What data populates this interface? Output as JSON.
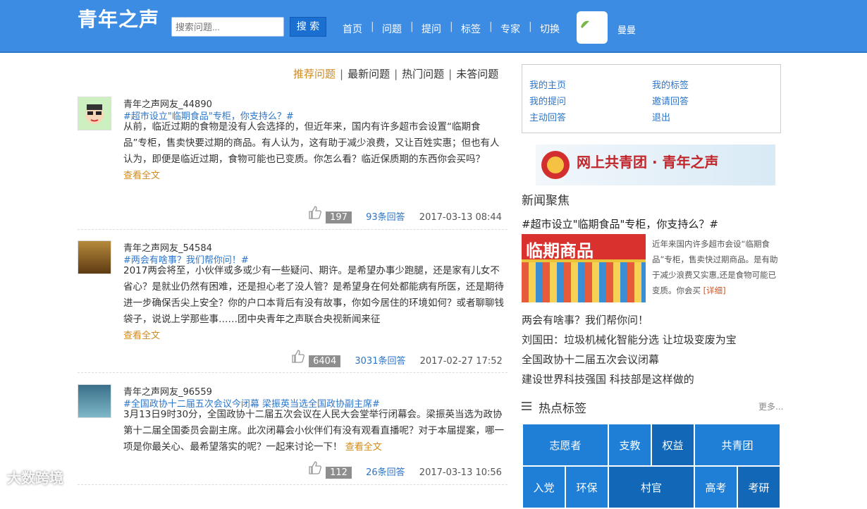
{
  "header": {
    "logo": "青年之声",
    "search_placeholder": "搜索问题...",
    "search_button": "搜 索",
    "nav": [
      "首页",
      "问题",
      "提问",
      "标签",
      "专家",
      "切换"
    ],
    "username": "曼曼"
  },
  "sort_tabs": [
    "推荐问题",
    "最新问题",
    "热门问题",
    "未答问题"
  ],
  "posts": [
    {
      "user": "青年之声网友_44890",
      "tag": "#超市设立\"临期食品\"专柜，你支持么？#",
      "body": "从前，临近过期的食物是没有人会选择的，但近年来，国内有许多超市会设置“临期食品”专柜，售卖快要过期的商品。有人认为，这有助于减少浪费，又让百姓实惠；但也有人认为，即便是临近过期，食物可能也已变质。你怎么看？临近保质期的东西你会买吗？",
      "read_more": "查看全文",
      "likes": "197",
      "answers": "93条回答",
      "time": "2017-03-13 08:44"
    },
    {
      "user": "青年之声网友_54584",
      "tag": "#两会有啥事？我们帮你问！#",
      "body": "2017两会将至，小伙伴或多或少有一些疑问、期许。是希望办事少跑腿，还是家有儿女不省心？是就业仍然有困难，还是担心老了没人管？是希望身在何处都能病有所医，还是期待进一步确保舌尖上安全？你的户口本背后有没有故事，你如今居住的环境如何？或者聊聊钱袋子，说说上学那些事……团中央青年之声联合央视新闻来征",
      "read_more": "查看全文",
      "likes": "6404",
      "answers": "3031条回答",
      "time": "2017-02-27 17:52"
    },
    {
      "user": "青年之声网友_96559",
      "tag": "#全国政协十二届五次会议今闭幕 梁振英当选全国政协副主席#",
      "body": "3月13日9时30分，全国政协十二届五次会议在人民大会堂举行闭幕会。梁振英当选为政协第十二届全国委员会副主席。此次闭幕会小伙伴们有没有观看直播呢？对于本届提案，哪一项是你最关心、最希望落实的呢？一起来讨论一下！",
      "read_more": "查看全文",
      "likes": "112",
      "answers": "26条回答",
      "time": "2017-03-13 10:56"
    }
  ],
  "user_panel": {
    "links": [
      "我的主页",
      "我的标签",
      "我的提问",
      "邀请回答",
      "主动回答",
      "退出"
    ]
  },
  "banner": "网上共青团 · 青年之声",
  "news": {
    "title": "新闻聚焦",
    "headline": "#超市设立\"临期食品\"专柜，你支持么？#",
    "image_text": "临期商品",
    "summary": "近年来国内许多超市会设“临期食品”专柜，售卖快过期商品。是有助于减少浪费又实惠,还是食物可能已变质。你会买",
    "detail": "[详细]",
    "links": [
      "两会有啥事？我们帮你问！",
      "刘国田：垃圾机械化智能分选 让垃圾变废为宝",
      "全国政协十二届五次会议闭幕",
      "建设世界科技强国 科技部是这样做的"
    ]
  },
  "hot_tags": {
    "title": "热点标签",
    "more": "更多...",
    "tags": [
      "志愿者",
      "支教",
      "权益",
      "共青团",
      "入党",
      "环保",
      "村官",
      "高考",
      "考研"
    ]
  },
  "watermark": "大数跨境"
}
